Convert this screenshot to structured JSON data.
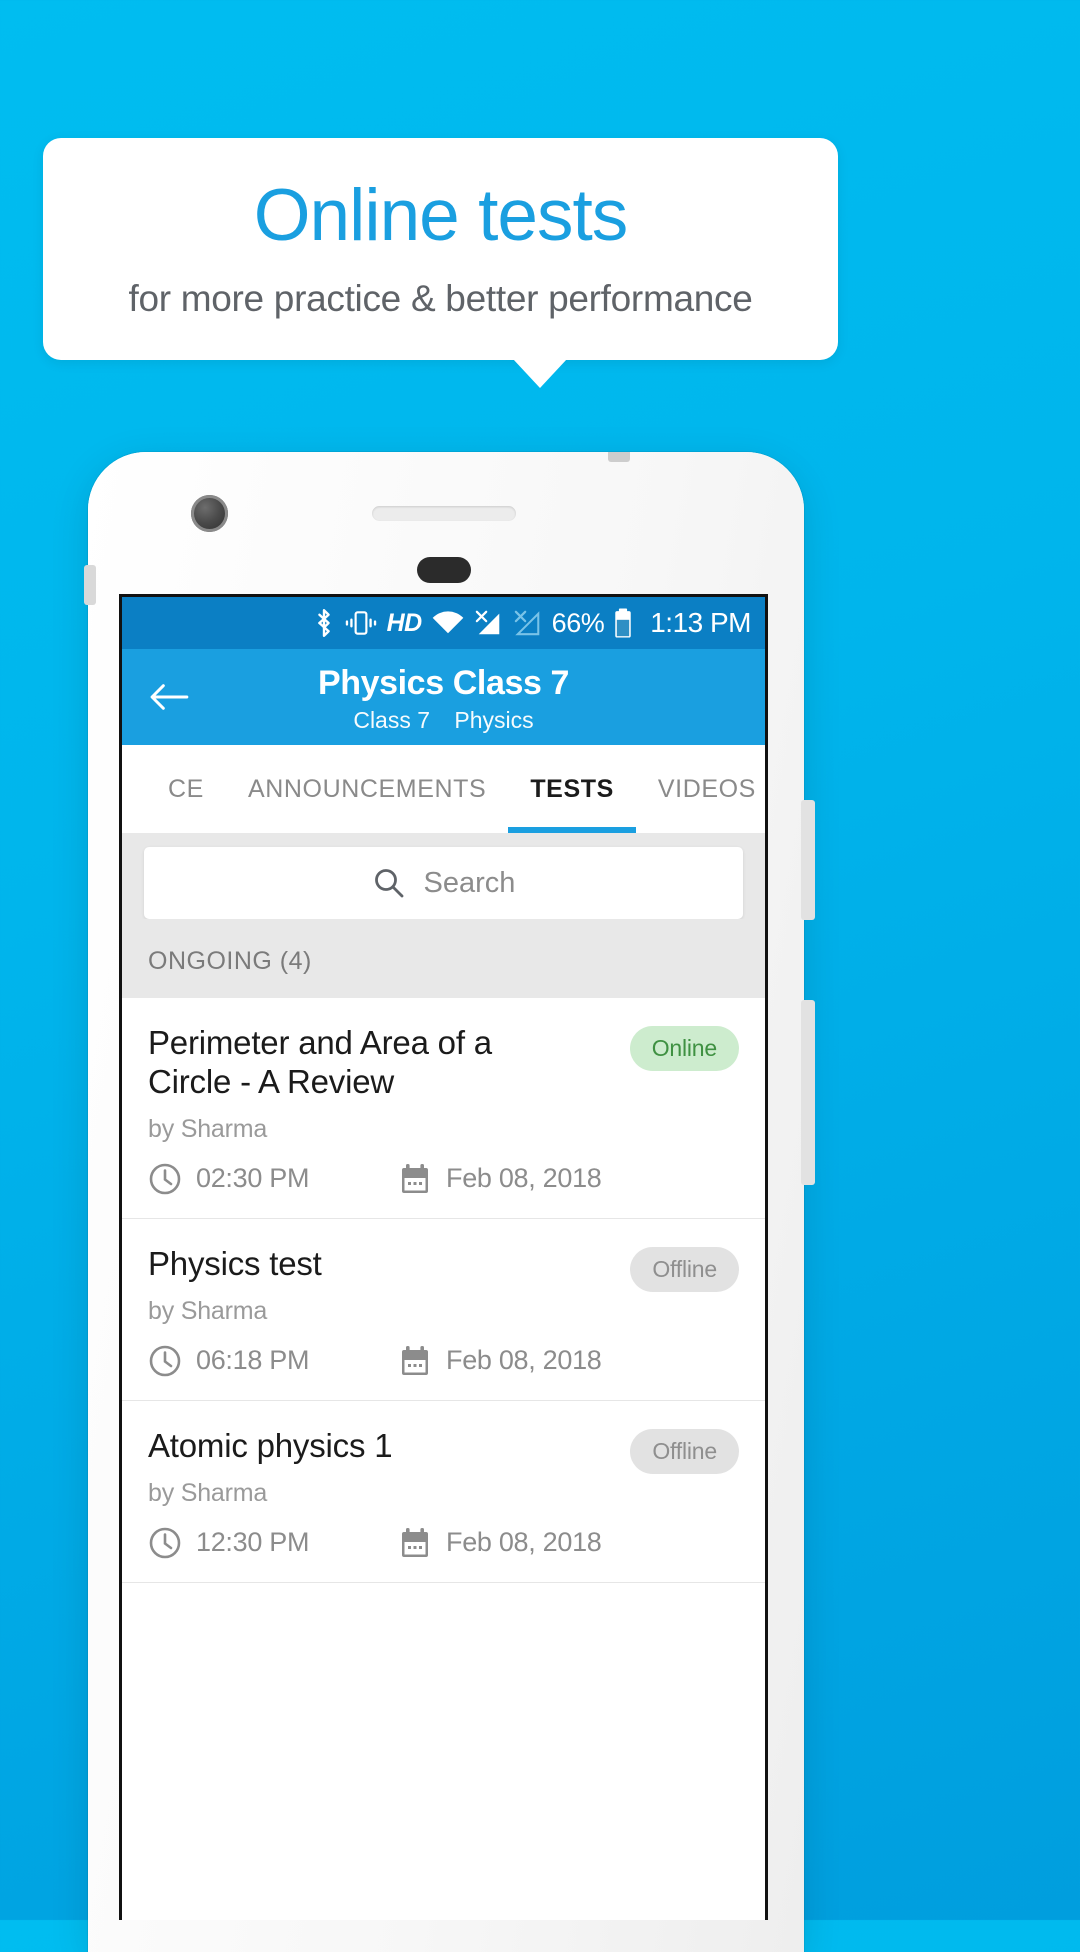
{
  "promo": {
    "title": "Online tests",
    "subtitle": "for more practice & better performance",
    "title_color": "#1a9fe0",
    "subtitle_color": "#5f6368",
    "background_color": "#00b5ec"
  },
  "statusbar": {
    "icons": [
      "bluetooth-icon",
      "vibrate-icon",
      "hd-icon",
      "wifi-icon",
      "signal-1-no-sim-icon",
      "signal-2-no-sim-icon"
    ],
    "hd_label": "HD",
    "battery_percent": "66%",
    "time": "1:13 PM",
    "background_color": "#0b7fc4"
  },
  "appbar": {
    "back_icon": "arrow-left-icon",
    "title": "Physics Class 7",
    "subtitle_class": "Class 7",
    "subtitle_subject": "Physics",
    "background_color": "#1a9fe0"
  },
  "tabs": {
    "items": [
      {
        "label": "CE",
        "active": false
      },
      {
        "label": "ANNOUNCEMENTS",
        "active": false
      },
      {
        "label": "TESTS",
        "active": true
      },
      {
        "label": "VIDEOS",
        "active": false
      }
    ],
    "indicator_color": "#1a9fe0"
  },
  "search": {
    "icon": "search-icon",
    "placeholder": "Search",
    "value": ""
  },
  "section": {
    "label": "ONGOING (4)",
    "count": 4
  },
  "tests": [
    {
      "title": "Perimeter and Area of a Circle - A Review",
      "author": "by Sharma",
      "time": "02:30 PM",
      "date": "Feb 08, 2018",
      "status": "Online",
      "status_type": "online"
    },
    {
      "title": "Physics test",
      "author": "by Sharma",
      "time": "06:18 PM",
      "date": "Feb 08, 2018",
      "status": "Offline",
      "status_type": "offline"
    },
    {
      "title": "Atomic physics 1",
      "author": "by Sharma",
      "time": "12:30 PM",
      "date": "Feb 08, 2018",
      "status": "Offline",
      "status_type": "offline"
    }
  ],
  "badge_colors": {
    "online_bg": "#cdecce",
    "online_fg": "#3f9142",
    "offline_bg": "#e2e2e2",
    "offline_fg": "#8f8f8f"
  }
}
